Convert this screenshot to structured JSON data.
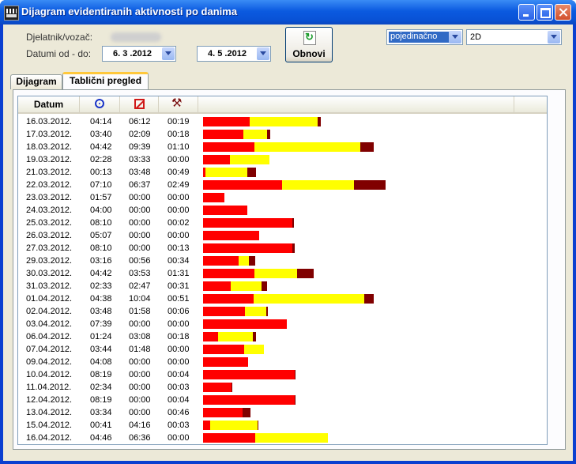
{
  "window": {
    "title": "Dijagram evidentiranih aktivnosti po danima"
  },
  "form": {
    "employee_label": "Djelatnik/vozač:",
    "dates_label": "Datumi od - do:",
    "date_from": "6. 3 .2012",
    "date_to": "4. 5 .2012",
    "refresh_label": "Obnovi",
    "mode_value": "pojedinačno",
    "view_value": "2D"
  },
  "tabs": [
    {
      "label": "Dijagram",
      "active": false
    },
    {
      "label": "Tablični pregled",
      "active": true
    }
  ],
  "table": {
    "columns": {
      "date": "Datum",
      "col1_icon": "driving-circle-icon",
      "col2_icon": "availability-box-icon",
      "col3_icon": "work-hammers-icon"
    },
    "colors": {
      "driving": "#ff0000",
      "availability": "#ffff00",
      "work": "#800000"
    },
    "rows": [
      {
        "date": "16.03.2012.",
        "c1": "04:14",
        "c2": "06:12",
        "c3": "00:19"
      },
      {
        "date": "17.03.2012.",
        "c1": "03:40",
        "c2": "02:09",
        "c3": "00:18"
      },
      {
        "date": "18.03.2012.",
        "c1": "04:42",
        "c2": "09:39",
        "c3": "01:10"
      },
      {
        "date": "19.03.2012.",
        "c1": "02:28",
        "c2": "03:33",
        "c3": "00:00"
      },
      {
        "date": "21.03.2012.",
        "c1": "00:13",
        "c2": "03:48",
        "c3": "00:49"
      },
      {
        "date": "22.03.2012.",
        "c1": "07:10",
        "c2": "06:37",
        "c3": "02:49"
      },
      {
        "date": "23.03.2012.",
        "c1": "01:57",
        "c2": "00:00",
        "c3": "00:00"
      },
      {
        "date": "24.03.2012.",
        "c1": "04:00",
        "c2": "00:00",
        "c3": "00:00"
      },
      {
        "date": "25.03.2012.",
        "c1": "08:10",
        "c2": "00:00",
        "c3": "00:02"
      },
      {
        "date": "26.03.2012.",
        "c1": "05:07",
        "c2": "00:00",
        "c3": "00:00"
      },
      {
        "date": "27.03.2012.",
        "c1": "08:10",
        "c2": "00:00",
        "c3": "00:13"
      },
      {
        "date": "29.03.2012.",
        "c1": "03:16",
        "c2": "00:56",
        "c3": "00:34"
      },
      {
        "date": "30.03.2012.",
        "c1": "04:42",
        "c2": "03:53",
        "c3": "01:31"
      },
      {
        "date": "31.03.2012.",
        "c1": "02:33",
        "c2": "02:47",
        "c3": "00:31"
      },
      {
        "date": "01.04.2012.",
        "c1": "04:38",
        "c2": "10:04",
        "c3": "00:51"
      },
      {
        "date": "02.04.2012.",
        "c1": "03:48",
        "c2": "01:58",
        "c3": "00:06"
      },
      {
        "date": "03.04.2012.",
        "c1": "07:39",
        "c2": "00:00",
        "c3": "00:00"
      },
      {
        "date": "06.04.2012.",
        "c1": "01:24",
        "c2": "03:08",
        "c3": "00:18"
      },
      {
        "date": "07.04.2012.",
        "c1": "03:44",
        "c2": "01:48",
        "c3": "00:00"
      },
      {
        "date": "09.04.2012.",
        "c1": "04:08",
        "c2": "00:00",
        "c3": "00:00"
      },
      {
        "date": "10.04.2012.",
        "c1": "08:19",
        "c2": "00:00",
        "c3": "00:04"
      },
      {
        "date": "11.04.2012.",
        "c1": "02:34",
        "c2": "00:00",
        "c3": "00:03"
      },
      {
        "date": "12.04.2012.",
        "c1": "08:19",
        "c2": "00:00",
        "c3": "00:04"
      },
      {
        "date": "13.04.2012.",
        "c1": "03:34",
        "c2": "00:00",
        "c3": "00:46"
      },
      {
        "date": "15.04.2012.",
        "c1": "00:41",
        "c2": "04:16",
        "c3": "00:03"
      },
      {
        "date": "16.04.2012.",
        "c1": "04:46",
        "c2": "06:36",
        "c3": "00:00"
      }
    ]
  }
}
